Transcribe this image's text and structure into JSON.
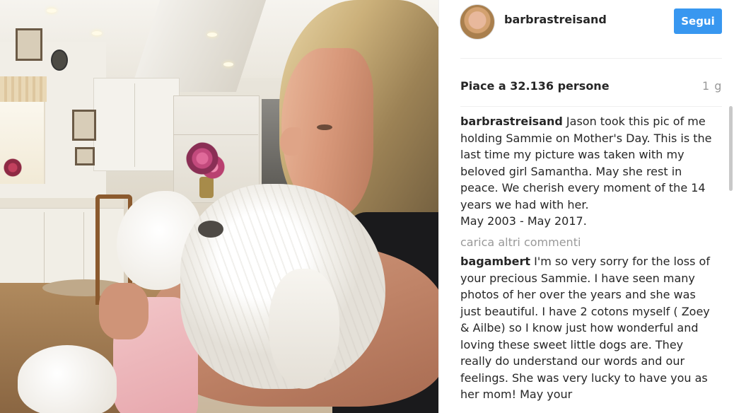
{
  "post": {
    "username": "barbrastreisand",
    "follow_label": "Segui",
    "likes": "Piace a 32.136 persone",
    "time_ago": "1 g"
  },
  "comments": [
    {
      "user": "barbrastreisand",
      "text": " Jason took this pic of me holding Sammie on Mother's Day. This is the last time my picture was taken with my beloved girl Samantha. May she rest in peace. We cherish every moment of the 14 years we had with her.",
      "extra": "May 2003 - May 2017."
    },
    {
      "user": "bagambert",
      "text": " I'm so very sorry for the loss of your precious Sammie. I have seen many photos of her over the years and she was just beautiful. I have 2 cotons myself ( Zoey & Ailbe) so I know just how wonderful and loving these sweet little dogs are. They really do understand our words and our feelings. She was very lucky to have you as her mom! May your"
    }
  ],
  "load_more_label": "carica altri commenti",
  "colors": {
    "follow_button": "#3897f0",
    "text": "#262626",
    "muted": "#999999"
  },
  "icons": {
    "avatar": "profile-photo"
  }
}
